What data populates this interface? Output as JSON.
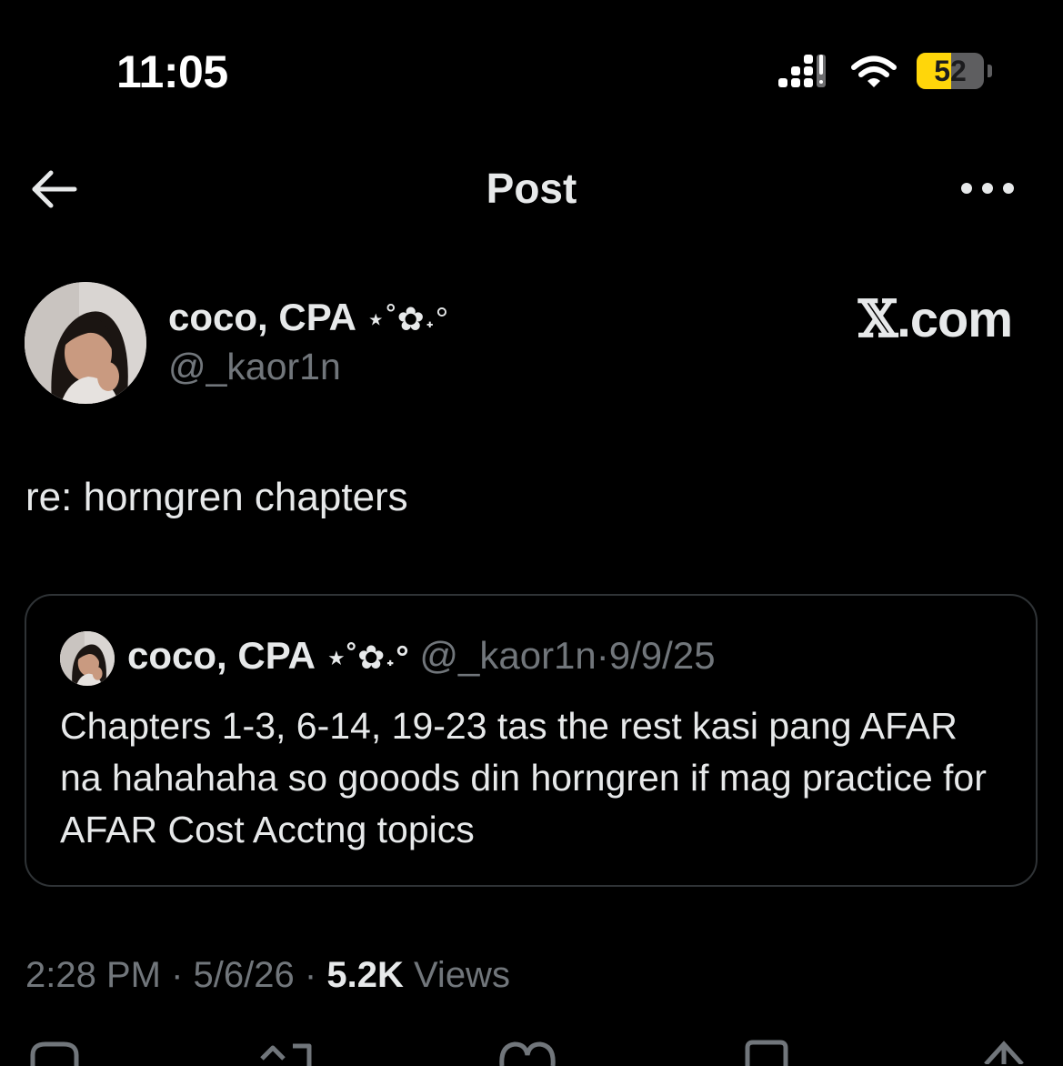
{
  "status_bar": {
    "time": "11:05",
    "battery_percent": "52",
    "battery_level": 0.52,
    "icons": [
      "cellular-signal-icon",
      "wifi-icon",
      "battery-icon"
    ]
  },
  "header": {
    "title": "Post",
    "back_icon": "arrow-left-icon",
    "more_icon": "more-horizontal-icon"
  },
  "post": {
    "author": {
      "display_name": "coco, CPA",
      "name_decoration": "⋆˚✿˖°",
      "handle": "@_kaor1n"
    },
    "watermark": {
      "x": "𝕏",
      "domain": ".com"
    },
    "text": "re: horngren chapters",
    "quoted": {
      "display_name": "coco, CPA",
      "name_decoration": "⋆˚✿˖°",
      "handle": "@_kaor1n",
      "separator": "·",
      "date": "9/9/25",
      "text": "Chapters 1-3, 6-14, 19-23 tas the rest kasi pang AFAR na hahahaha so gooods din horngren if mag practice for AFAR Cost Acctng topics"
    },
    "meta": {
      "time": "2:28 PM",
      "separator": "·",
      "date": "5/6/26",
      "views_count": "5.2K",
      "views_label": "Views"
    }
  },
  "colors": {
    "background": "#000000",
    "text_primary": "#e7e9ea",
    "text_secondary": "#71767b",
    "border": "#2f3336",
    "battery_yellow": "#ffd60a"
  }
}
